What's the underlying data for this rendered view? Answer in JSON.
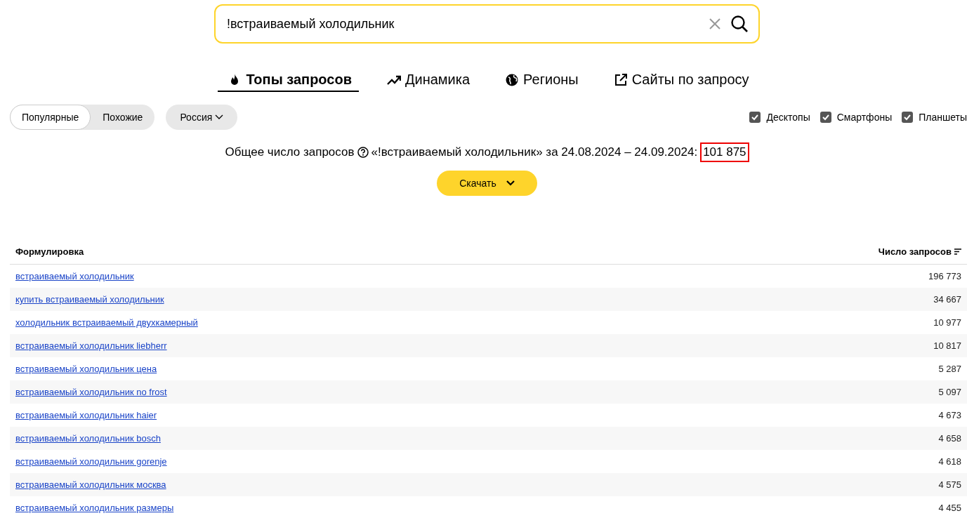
{
  "search": {
    "value": "!встраиваемый холодильник"
  },
  "tabs": [
    {
      "label": "Топы запросов",
      "kind": "fire",
      "selected": true
    },
    {
      "label": "Динамика",
      "kind": "trend",
      "selected": false
    },
    {
      "label": "Регионы",
      "kind": "globe",
      "selected": false
    },
    {
      "label": "Сайты по запросу",
      "kind": "external",
      "selected": false
    }
  ],
  "mode_switch": [
    {
      "label": "Популярные",
      "selected": true
    },
    {
      "label": "Похожие",
      "selected": false
    }
  ],
  "region": {
    "label": "Россия"
  },
  "devices": [
    {
      "label": "Десктопы",
      "checked": true
    },
    {
      "label": "Смартфоны",
      "checked": true
    },
    {
      "label": "Планшеты",
      "checked": true
    }
  ],
  "summary": {
    "text": "Общее число запросов",
    "query": "«!встраиваемый холодильник» за 24.08.2024 – 24.09.2024:",
    "total": "101 875",
    "total_highlighted": true
  },
  "download_button": {
    "label": "Скачать"
  },
  "table": {
    "columns": [
      "Формулировка",
      "Число запросов"
    ],
    "rows": [
      {
        "phrase": "встраиваемый холодильник",
        "count": "196 773"
      },
      {
        "phrase": "купить встраиваемый холодильник",
        "count": "34 667"
      },
      {
        "phrase": "холодильник встраиваемый двухкамерный",
        "count": "10 977"
      },
      {
        "phrase": "встраиваемый холодильник liebherr",
        "count": "10 817"
      },
      {
        "phrase": "встраиваемый холодильник цена",
        "count": "5 287"
      },
      {
        "phrase": "встраиваемый холодильник no frost",
        "count": "5 097"
      },
      {
        "phrase": "встраиваемый холодильник haier",
        "count": "4 673"
      },
      {
        "phrase": "встраиваемый холодильник bosch",
        "count": "4 658"
      },
      {
        "phrase": "встраиваемый холодильник gorenje",
        "count": "4 618"
      },
      {
        "phrase": "встраиваемый холодильник москва",
        "count": "4 575"
      },
      {
        "phrase": "встраиваемый холодильник размеры",
        "count": "4 455"
      }
    ]
  }
}
